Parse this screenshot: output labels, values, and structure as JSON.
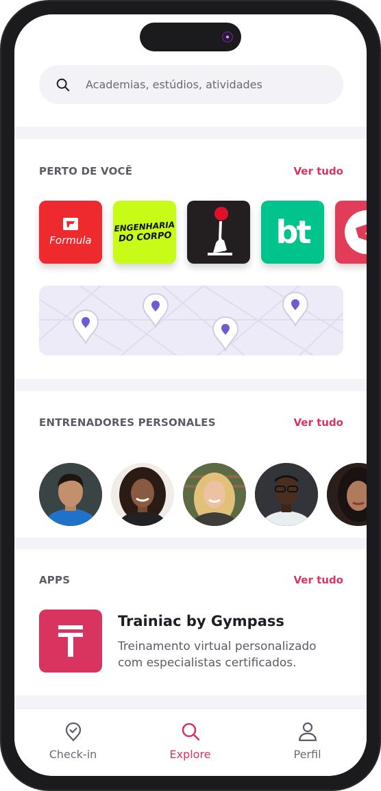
{
  "search": {
    "placeholder": "Academias, estúdios, atividades"
  },
  "nearby": {
    "title": "PERTO DE VOCÊ",
    "see_all": "Ver tudo",
    "brands": [
      {
        "name": "formula",
        "label": "Formula",
        "color": "#ee2a2f"
      },
      {
        "name": "engenharia",
        "line1": "ENGENHARIA",
        "line2": "DO CORPO",
        "color": "#c8fb17"
      },
      {
        "name": "pilates",
        "color": "#231f20"
      },
      {
        "name": "bt",
        "label": "bt",
        "color": "#00c48c"
      },
      {
        "name": "partial",
        "color": "#e33c59"
      }
    ]
  },
  "trainers": {
    "title": "ENTRENADORES PERSONALES",
    "see_all": "Ver tudo"
  },
  "apps": {
    "title": "APPS",
    "see_all": "Ver tudo",
    "item": {
      "title": "Trainiac by Gympass",
      "description": "Treinamento virtual personalizado com especialistas certificados."
    }
  },
  "tabs": [
    {
      "label": "Check-in",
      "icon": "check-in-pin-icon"
    },
    {
      "label": "Explore",
      "icon": "search-icon",
      "active": true
    },
    {
      "label": "Perfil",
      "icon": "user-icon"
    }
  ],
  "colors": {
    "accent": "#d8345f",
    "background": "#f4f3f7"
  }
}
